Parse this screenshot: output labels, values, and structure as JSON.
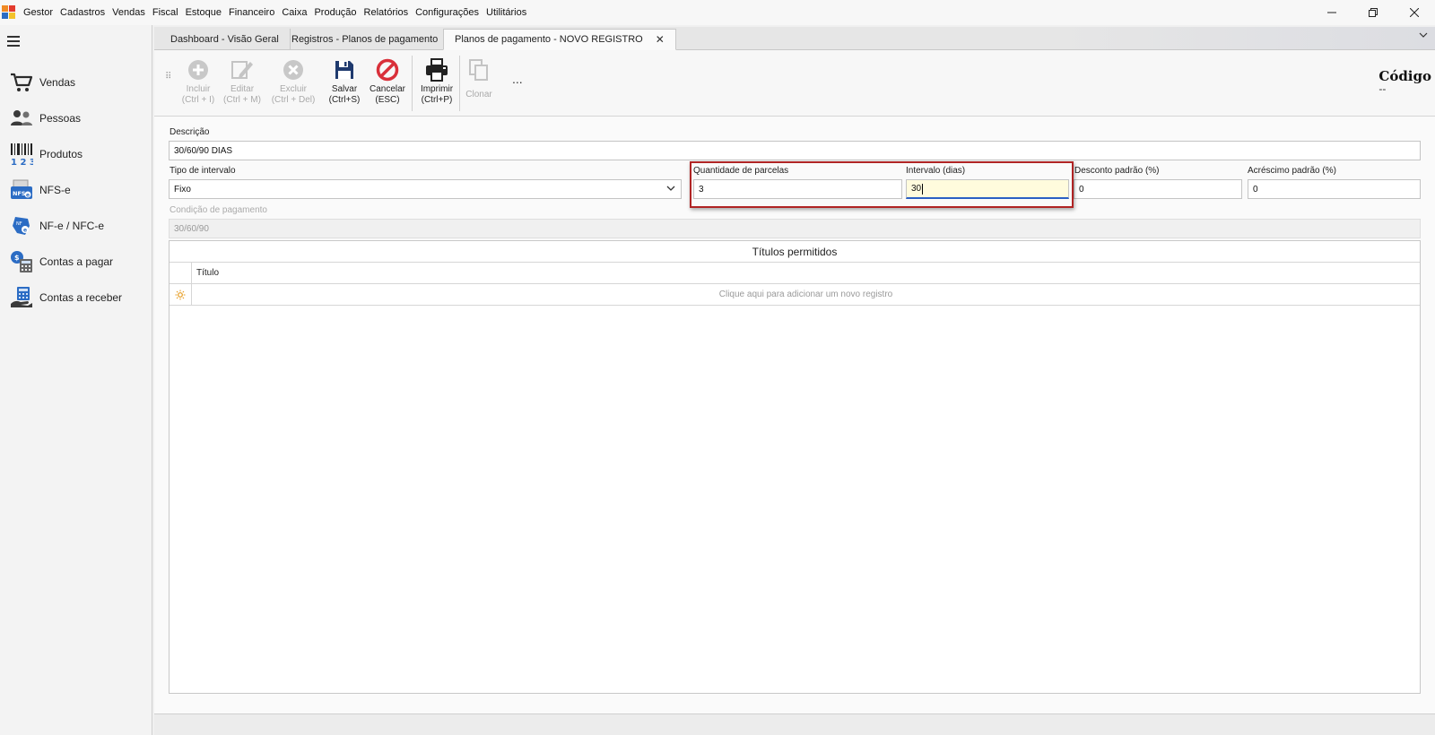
{
  "menu": {
    "items": [
      "Gestor",
      "Cadastros",
      "Vendas",
      "Fiscal",
      "Estoque",
      "Financeiro",
      "Caixa",
      "Produção",
      "Relatórios",
      "Configurações",
      "Utilitários"
    ]
  },
  "sidebar": {
    "items": [
      {
        "label": "Vendas",
        "icon": "cart-icon"
      },
      {
        "label": "Pessoas",
        "icon": "people-icon"
      },
      {
        "label": "Produtos",
        "icon": "barcode-icon"
      },
      {
        "label": "NFS-e",
        "icon": "nfse-icon"
      },
      {
        "label": "NF-e / NFC-e",
        "icon": "nfe-icon"
      },
      {
        "label": "Contas a pagar",
        "icon": "accounts-payable-icon"
      },
      {
        "label": "Contas a receber",
        "icon": "accounts-receivable-icon"
      }
    ]
  },
  "tabs": [
    {
      "label": "Dashboard - Visão Geral"
    },
    {
      "label": "Registros - Planos de pagamento"
    },
    {
      "label": "Planos de pagamento - NOVO REGISTRO",
      "active": true
    }
  ],
  "toolbar": {
    "incluir": {
      "label": "Incluir",
      "shortcut": "(Ctrl + I)"
    },
    "editar": {
      "label": "Editar",
      "shortcut": "(Ctrl + M)"
    },
    "excluir": {
      "label": "Excluir",
      "shortcut": "(Ctrl + Del)"
    },
    "salvar": {
      "label": "Salvar",
      "shortcut": "(Ctrl+S)"
    },
    "cancelar": {
      "label": "Cancelar",
      "shortcut": "(ESC)"
    },
    "imprimir": {
      "label": "Imprimir",
      "shortcut": "(Ctrl+P)"
    },
    "clonar": {
      "label": "Clonar"
    },
    "more": "..."
  },
  "codigo": {
    "label": "Código",
    "value": "--"
  },
  "form": {
    "descricao": {
      "label": "Descrição",
      "value": "30/60/90 DIAS"
    },
    "tipo_intervalo": {
      "label": "Tipo de intervalo",
      "value": "Fixo"
    },
    "quantidade_parcelas": {
      "label": "Quantidade de parcelas",
      "value": "3"
    },
    "intervalo_dias": {
      "label": "Intervalo (dias)",
      "value": "30"
    },
    "desconto_padrao": {
      "label": "Desconto padrão (%)",
      "value": "0"
    },
    "acrescimo_padrao": {
      "label": "Acréscimo padrão (%)",
      "value": "0"
    },
    "condicao_pagamento": {
      "label": "Condição de pagamento",
      "value": "30/60/90"
    }
  },
  "grid": {
    "title": "Títulos permitidos",
    "column": "Título",
    "new_row_hint": "Clique aqui para adicionar um novo registro"
  },
  "colors": {
    "highlight": "#b02424",
    "focus_field": "#fffbdd",
    "save_blue": "#1f3a6e",
    "cancel_red": "#d9303a"
  }
}
